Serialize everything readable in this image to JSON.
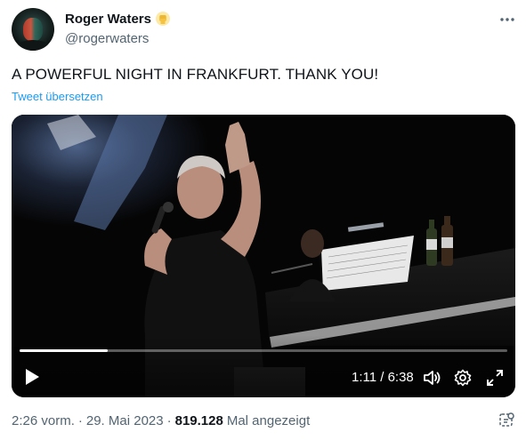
{
  "author": {
    "display_name": "Roger Waters",
    "handle": "@rogerwaters"
  },
  "tweet": {
    "text": "A POWERFUL NIGHT IN FRANKFURT. THANK YOU!",
    "translate_label": "Tweet übersetzen"
  },
  "video": {
    "progress_fraction": 0.18,
    "time": "1:11 / 6:38"
  },
  "meta": {
    "time": "2:26 vorm.",
    "separator1": "·",
    "date": "29. Mai 2023",
    "separator2": "·",
    "views": "819.128",
    "views_label": "Mal angezeigt"
  },
  "colors": {
    "accent": "#1d9bf0",
    "badge": "#f5c242",
    "text_secondary": "#536471"
  },
  "icons": {
    "more": "more-horizontal-icon",
    "play": "play-icon",
    "volume": "volume-icon",
    "settings": "gear-icon",
    "fullscreen": "fullscreen-icon",
    "analytics": "analytics-icon",
    "badge": "raised-fist-badge-icon"
  }
}
